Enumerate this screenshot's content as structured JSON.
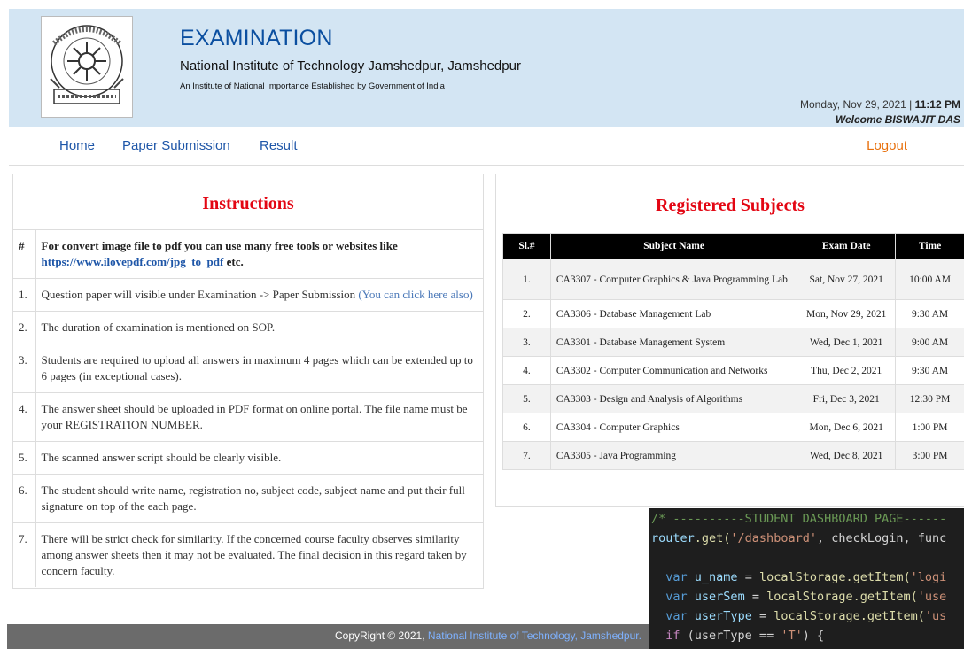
{
  "header": {
    "title": "EXAMINATION",
    "subtitle": "National Institute of Technology Jamshedpur, Jamshedpur",
    "tagline": "An Institute of National Importance Established by Government of India",
    "date": "Monday, Nov 29, 2021 |",
    "time": "11:12 PM",
    "welcome": "Welcome BISWAJIT DAS"
  },
  "nav": {
    "home": "Home",
    "paper_submission": "Paper Submission",
    "result": "Result",
    "logout": "Logout"
  },
  "instructions": {
    "title": "Instructions",
    "head_marker": "#",
    "head_text": "For convert image file to pdf you can use many free tools or websites like ",
    "head_link": "https://www.ilovepdf.com/jpg_to_pdf",
    "head_suffix": " etc.",
    "items": [
      {
        "num": "1.",
        "text": "Question paper will visible under Examination -> Paper Submission ",
        "link": "(You can click here also)"
      },
      {
        "num": "2.",
        "text": "The duration of examination is mentioned on SOP."
      },
      {
        "num": "3.",
        "text": "Students are required to upload all answers in maximum 4 pages which can be extended up to 6 pages (in exceptional cases)."
      },
      {
        "num": "4.",
        "text": "The answer sheet should be uploaded in PDF format on online portal. The file name must be your REGISTRATION NUMBER."
      },
      {
        "num": "5.",
        "text": "The scanned answer script should be clearly visible."
      },
      {
        "num": "6.",
        "text": "The student should write name, registration no, subject code, subject name and put their full signature on top of the each page."
      },
      {
        "num": "7.",
        "text": "There will be strict check for similarity. If the concerned course faculty observes similarity among answer sheets then it may not be evaluated. The final decision in this regard taken by concern faculty."
      }
    ]
  },
  "subjects": {
    "title": "Registered Subjects",
    "columns": [
      "Sl.#",
      "Subject Name",
      "Exam Date",
      "Time"
    ],
    "rows": [
      [
        "1.",
        "CA3307 - Computer Graphics & Java Programming Lab",
        "Sat, Nov 27, 2021",
        "10:00 AM"
      ],
      [
        "2.",
        "CA3306 - Database Management Lab",
        "Mon, Nov 29, 2021",
        "9:30 AM"
      ],
      [
        "3.",
        "CA3301 - Database Management System",
        "Wed, Dec 1, 2021",
        "9:00 AM"
      ],
      [
        "4.",
        "CA3302 - Computer Communication and Networks",
        "Thu, Dec 2, 2021",
        "9:30 AM"
      ],
      [
        "5.",
        "CA3303 - Design and Analysis of Algorithms",
        "Fri, Dec 3, 2021",
        "12:30 PM"
      ],
      [
        "6.",
        "CA3304 - Computer Graphics",
        "Mon, Dec 6, 2021",
        "1:00 PM"
      ],
      [
        "7.",
        "CA3305 - Java Programming",
        "Wed, Dec 8, 2021",
        "3:00 PM"
      ]
    ]
  },
  "footer": {
    "prefix": "CopyRight © 2021, ",
    "link": "National Institute of Technology, Jamshedpur."
  },
  "code_overlay": {
    "line1": "/* ----------STUDENT DASHBOARD PAGE------",
    "line2_a": "router",
    "line2_b": ".get(",
    "line2_c": "'/dashboard'",
    "line2_d": ", checkLogin, func",
    "line4_var": "u_name",
    "line4_call": "localStorage.getItem(",
    "line4_str": "'logi",
    "line5_var": "userSem",
    "line5_str": "'use",
    "line6_var": "userType",
    "line6_str": "'us",
    "line7_kw": "if",
    "line7_cond": " (userType == ",
    "line7_str": "'T'",
    "line7_end": ") {"
  },
  "colors": {
    "header_bg": "#d3e5f3",
    "title_blue": "#0b4fa0",
    "panel_title_red": "#e30613",
    "logout_orange": "#e8700c",
    "footer_bg": "#6b6b6b"
  }
}
